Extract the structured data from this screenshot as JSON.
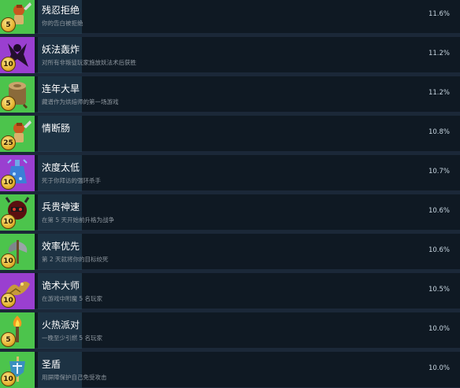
{
  "achievements": [
    {
      "title": "残忍拒绝",
      "desc": "你的告白被拒绝",
      "pct": "11.6%",
      "badge": "5",
      "icon": "hero-green-icon",
      "bg": "#4cc44c"
    },
    {
      "title": "妖法轰炸",
      "desc": "对所有非叛徒玩家施放妖法术后获胜",
      "pct": "11.2%",
      "badge": "10",
      "icon": "shadow-figure-icon",
      "bg": "#9a3fd0"
    },
    {
      "title": "连年大旱",
      "desc": "藏谱作为烘焙师的第一场游戏",
      "pct": "11.2%",
      "badge": "5",
      "icon": "tree-stump-icon",
      "bg": "#4cc44c"
    },
    {
      "title": "情断肠",
      "desc": "",
      "pct": "10.8%",
      "badge": "25",
      "icon": "hero-green-icon",
      "bg": "#4cc44c"
    },
    {
      "title": "浓度太低",
      "desc": "死于你拜访的强环杀手",
      "pct": "10.7%",
      "badge": "10",
      "icon": "blue-potion-icon",
      "bg": "#9a3fd0"
    },
    {
      "title": "兵贵神速",
      "desc": "在第 5 天开始前升格为战争",
      "pct": "10.6%",
      "badge": "10",
      "icon": "war-mask-icon",
      "bg": "#4cc44c"
    },
    {
      "title": "效率优先",
      "desc": "第 2 天就将你的目标绞死",
      "pct": "10.6%",
      "badge": "10",
      "icon": "axe-icon",
      "bg": "#4cc44c"
    },
    {
      "title": "诡术大师",
      "desc": "在游戏中附魔 5 名玩家",
      "pct": "10.5%",
      "badge": "10",
      "icon": "gold-wing-icon",
      "bg": "#9a3fd0"
    },
    {
      "title": "火热派对",
      "desc": "一晚至少引燃 5 名玩家",
      "pct": "10.0%",
      "badge": "5",
      "icon": "torch-icon",
      "bg": "#4cc44c"
    },
    {
      "title": "圣盾",
      "desc": "用屏障保护自己免受攻击",
      "pct": "10.0%",
      "badge": "10",
      "icon": "shield-staff-icon",
      "bg": "#4cc44c"
    }
  ]
}
